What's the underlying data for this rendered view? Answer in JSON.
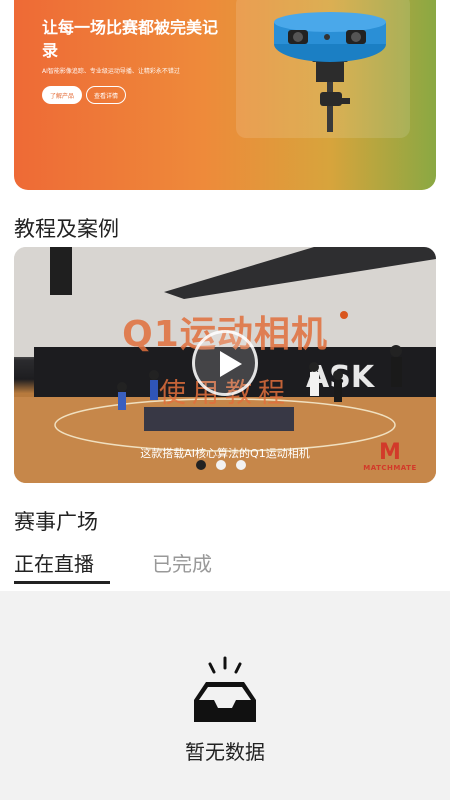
{
  "banner": {
    "title": "让每一场比赛都被完美记录",
    "subtitle": "AI智能影像追踪、专业级运动导播、让精彩永不错过",
    "learn_button": "了解产品",
    "details_button": "查看详情",
    "product_icon": "camera-device-icon"
  },
  "tutorials": {
    "title": "教程及案例",
    "video": {
      "title": "Q1运动相机",
      "subtitle": "使用教程",
      "caption": "这款搭载AI核心算法的Q1运动相机",
      "brand": "MATCHMATE",
      "brand_logo": "M",
      "play_icon": "play-icon"
    },
    "carousel": {
      "total": 3,
      "active": 1
    }
  },
  "events": {
    "title": "赛事广场",
    "tabs": [
      {
        "label": "正在直播",
        "active": true
      },
      {
        "label": "已完成",
        "active": false
      }
    ],
    "empty": {
      "text": "暂无数据",
      "icon": "empty-inbox-icon"
    }
  },
  "colors": {
    "accent_orange": "#ee6a36",
    "brand_red": "#d23a2a"
  }
}
